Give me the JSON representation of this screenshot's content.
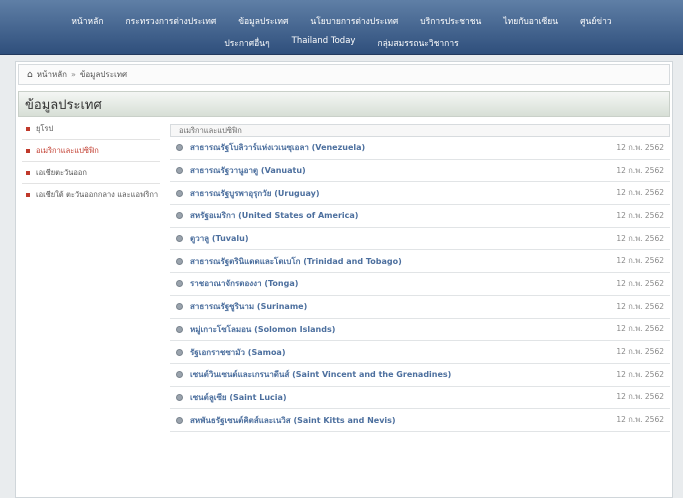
{
  "topnav": {
    "row1": [
      "หน้าหลัก",
      "กระทรวงการต่างประเทศ",
      "ข้อมูลประเทศ",
      "นโยบายการต่างประเทศ",
      "บริการประชาชน",
      "ไทยกับอาเซียน",
      "ศูนย์ข่าว"
    ],
    "row2": [
      "ประกาศอื่นๆ",
      "Thailand Today",
      "กลุ่มสมรรถนะวิชาการ"
    ]
  },
  "breadcrumb": {
    "home": "หน้าหลัก",
    "current": "ข้อมูลประเทศ"
  },
  "page_title": "ข้อมูลประเทศ",
  "sidebar": {
    "items": [
      {
        "label": "ยุโรป"
      },
      {
        "label": "อเมริกาและแปซิฟิก"
      },
      {
        "label": "เอเชียตะวันออก"
      },
      {
        "label": "เอเชียใต้ ตะวันออกกลาง และแอฟริกา"
      }
    ]
  },
  "list": {
    "header": "อเมริกาและแปซิฟิก",
    "rows": [
      {
        "title": "สาธารณรัฐโบลิวาร์แห่งเวเนซุเอลา (Venezuela)",
        "date": "12 ก.พ. 2562"
      },
      {
        "title": "สาธารณรัฐวานูอาตู (Vanuatu)",
        "date": "12 ก.พ. 2562"
      },
      {
        "title": "สาธารณรัฐบูรพาอุรุกวัย (Uruguay)",
        "date": "12 ก.พ. 2562"
      },
      {
        "title": "สหรัฐอเมริกา (United States of America)",
        "date": "12 ก.พ. 2562"
      },
      {
        "title": "ตูวาลู (Tuvalu)",
        "date": "12 ก.พ. 2562"
      },
      {
        "title": "สาธารณรัฐตรินิแดดและโตเบโก (Trinidad and Tobago)",
        "date": "12 ก.พ. 2562"
      },
      {
        "title": "ราชอาณาจักรตองงา (Tonga)",
        "date": "12 ก.พ. 2562"
      },
      {
        "title": "สาธารณรัฐซูรินาม (Suriname)",
        "date": "12 ก.พ. 2562"
      },
      {
        "title": "หมู่เกาะโซโลมอน (Solomon Islands)",
        "date": "12 ก.พ. 2562"
      },
      {
        "title": "รัฐเอกราชซามัว (Samoa)",
        "date": "12 ก.พ. 2562"
      },
      {
        "title": "เซนต์วินเซนต์และเกรนาดีนส์ (Saint Vincent and the Grenadines)",
        "date": "12 ก.พ. 2562"
      },
      {
        "title": "เซนต์ลูเซีย (Saint Lucia)",
        "date": "12 ก.พ. 2562"
      },
      {
        "title": "สหพันธรัฐเซนต์คิตส์และเนวิส (Saint Kitts and Nevis)",
        "date": "12 ก.พ. 2562"
      }
    ]
  },
  "colors": {
    "nav_bg": "#3f6290",
    "accent_red": "#c0392b",
    "link_blue": "#4c6f9e"
  }
}
